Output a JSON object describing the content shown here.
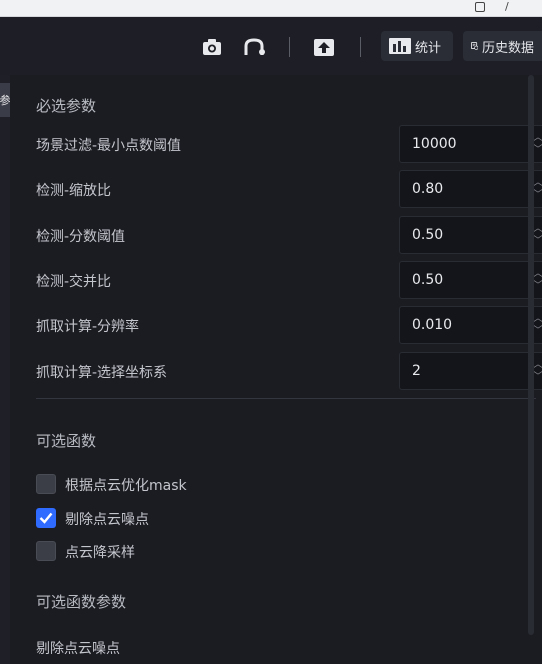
{
  "toolbar": {
    "icons": [
      "camera-icon",
      "route-icon",
      "upload-icon"
    ],
    "stats_label": "统计",
    "history_label": "历史数据"
  },
  "left_tab": {
    "label": "参"
  },
  "required": {
    "title": "必选参数",
    "params": [
      {
        "label": "场景过滤-最小点数阈值",
        "value": "10000"
      },
      {
        "label": "检测-缩放比",
        "value": "0.80"
      },
      {
        "label": "检测-分数阈值",
        "value": "0.50"
      },
      {
        "label": "检测-交并比",
        "value": "0.50"
      },
      {
        "label": "抓取计算-分辨率",
        "value": "0.010"
      },
      {
        "label": "抓取计算-选择坐标系",
        "value": "2"
      }
    ]
  },
  "optional": {
    "title": "可选函数",
    "functions": [
      {
        "label": "根据点云优化mask",
        "checked": false
      },
      {
        "label": "剔除点云噪点",
        "checked": true
      },
      {
        "label": "点云降采样",
        "checked": false
      }
    ]
  },
  "optional_params": {
    "title": "可选函数参数",
    "subsection": "剔除点云噪点"
  },
  "colors": {
    "accent": "#2f6bff",
    "background": "#1b1c22",
    "input_bg": "#14151a"
  }
}
